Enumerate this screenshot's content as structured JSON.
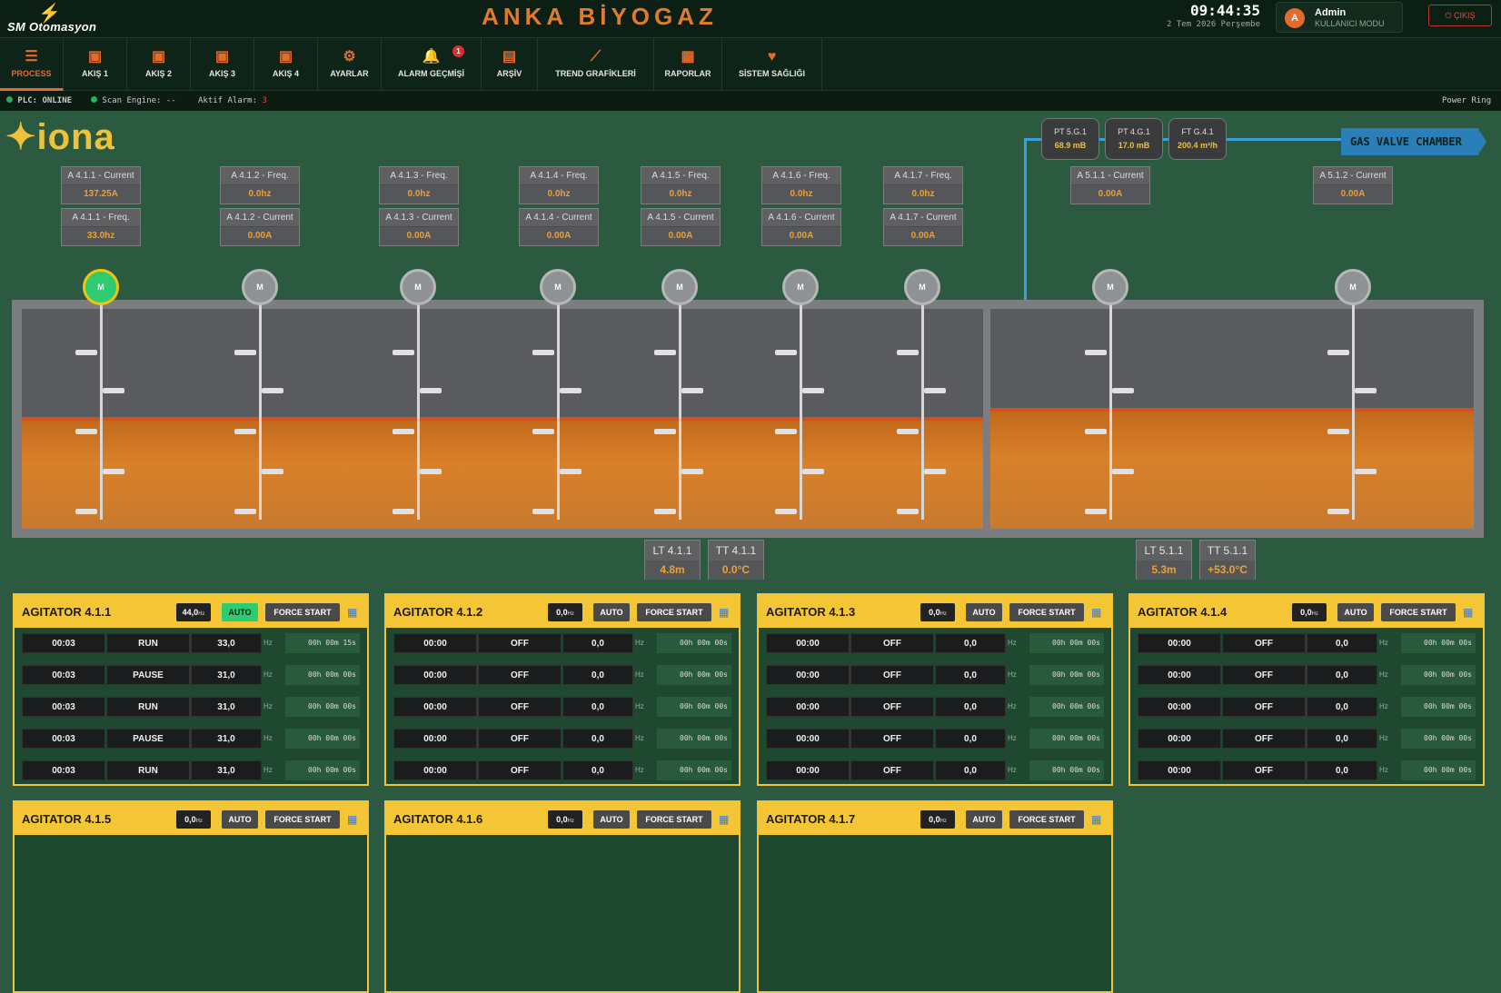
{
  "header": {
    "logo_text": "SM Otomasyon",
    "title": "ANKA BİYOGAZ",
    "time": "09:44:35",
    "date": "2 Tem 2026 Perşembe",
    "user_initial": "A",
    "user_name": "Admin",
    "user_role": "KULLANICI MODU",
    "logout_label": "ÇIKIŞ"
  },
  "nav": [
    {
      "label": "PROCESS",
      "icon": "list-icon",
      "glyph": "☰",
      "active": true
    },
    {
      "label": "AKIŞ 1",
      "icon": "calendar-icon",
      "glyph": "▣"
    },
    {
      "label": "AKIŞ 2",
      "icon": "calendar-icon",
      "glyph": "▣"
    },
    {
      "label": "AKIŞ 3",
      "icon": "calendar-icon",
      "glyph": "▣"
    },
    {
      "label": "AKIŞ 4",
      "icon": "calendar-icon",
      "glyph": "▣"
    },
    {
      "label": "AYARLAR",
      "icon": "gear-icon",
      "glyph": "⚙"
    },
    {
      "label": "ALARM GEÇMİŞİ",
      "icon": "bell-icon",
      "glyph": "🔔",
      "badge": "1"
    },
    {
      "label": "ARŞİV",
      "icon": "archive-icon",
      "glyph": "▤"
    },
    {
      "label": "TREND GRAFİKLERİ",
      "icon": "trend-icon",
      "glyph": "⟋"
    },
    {
      "label": "RAPORLAR",
      "icon": "report-icon",
      "glyph": "▦"
    },
    {
      "label": "SİSTEM SAĞLIĞI",
      "icon": "heart-icon",
      "glyph": "♥"
    }
  ],
  "status": {
    "plc": "PLC: ONLINE",
    "scan": "Scan Engine: --",
    "alarm_label": "Aktif Alarm:",
    "alarm_count": "3",
    "ring": "Power Ring"
  },
  "brand": "✦iona",
  "gas_sensors": [
    {
      "label": "PT 5.G.1",
      "value": "68.9 mB"
    },
    {
      "label": "PT 4.G.1",
      "value": "17.0 mB"
    },
    {
      "label": "FT G.4.1",
      "value": "200.4 m³/h"
    }
  ],
  "gas_valve_label": "GAS VALVE CHAMBER",
  "tags": [
    {
      "top_label": "A 4.1.1 - Current",
      "top_value": "137.25A",
      "bot_label": "A 4.1.1 - Freq.",
      "bot_value": "33.0hz"
    },
    {
      "top_label": "A 4.1.2 - Freq.",
      "top_value": "0.0hz",
      "bot_label": "A 4.1.2 - Current",
      "bot_value": "0.00A"
    },
    {
      "top_label": "A 4.1.3 - Freq.",
      "top_value": "0.0hz",
      "bot_label": "A 4.1.3 - Current",
      "bot_value": "0.00A"
    },
    {
      "top_label": "A 4.1.4 - Freq.",
      "top_value": "0.0hz",
      "bot_label": "A 4.1.4 - Current",
      "bot_value": "0.00A"
    },
    {
      "top_label": "A 4.1.5 - Freq.",
      "top_value": "0.0hz",
      "bot_label": "A 4.1.5 - Current",
      "bot_value": "0.00A"
    },
    {
      "top_label": "A 4.1.6 - Freq.",
      "top_value": "0.0hz",
      "bot_label": "A 4.1.6 - Current",
      "bot_value": "0.00A"
    },
    {
      "top_label": "A 4.1.7 - Freq.",
      "top_value": "0.0hz",
      "bot_label": "A 4.1.7 - Current",
      "bot_value": "0.00A"
    },
    {
      "top_label": "A 5.1.1 - Current",
      "top_value": "0.00A"
    },
    {
      "top_label": "A 5.1.2 - Current",
      "top_value": "0.00A"
    }
  ],
  "motor_label": "M",
  "motors_running": [
    true,
    false,
    false,
    false,
    false,
    false,
    false,
    false,
    false
  ],
  "tank_sensors": [
    {
      "label": "LT 4.1.1",
      "value": "4.8m"
    },
    {
      "label": "TT 4.1.1",
      "value": "0.0°C"
    },
    {
      "label": "LT 5.1.1",
      "value": "5.3m"
    },
    {
      "label": "TT 5.1.1",
      "value": "+53.0°C"
    }
  ],
  "agitators": [
    {
      "title": "AGITATOR 4.1.1",
      "hz": "44,0",
      "auto": "AUTO",
      "auto_on": true,
      "force": "FORCE START",
      "rows": [
        {
          "time": "00:03",
          "state": "RUN",
          "freq": "33,0",
          "dur": "00h 00m 15s"
        },
        {
          "time": "00:03",
          "state": "PAUSE",
          "freq": "31,0",
          "dur": "00h 00m 00s"
        },
        {
          "time": "00:03",
          "state": "RUN",
          "freq": "31,0",
          "dur": "00h 00m 00s"
        },
        {
          "time": "00:03",
          "state": "PAUSE",
          "freq": "31,0",
          "dur": "00h 00m 00s"
        },
        {
          "time": "00:03",
          "state": "RUN",
          "freq": "31,0",
          "dur": "00h 00m 00s"
        }
      ]
    },
    {
      "title": "AGITATOR 4.1.2",
      "hz": "0,0",
      "auto": "AUTO",
      "auto_on": false,
      "force": "FORCE START",
      "rows": [
        {
          "time": "00:00",
          "state": "OFF",
          "freq": "0,0",
          "dur": "00h 00m 00s"
        },
        {
          "time": "00:00",
          "state": "OFF",
          "freq": "0,0",
          "dur": "00h 00m 00s"
        },
        {
          "time": "00:00",
          "state": "OFF",
          "freq": "0,0",
          "dur": "00h 00m 00s"
        },
        {
          "time": "00:00",
          "state": "OFF",
          "freq": "0,0",
          "dur": "00h 00m 00s"
        },
        {
          "time": "00:00",
          "state": "OFF",
          "freq": "0,0",
          "dur": "00h 00m 00s"
        }
      ]
    },
    {
      "title": "AGITATOR 4.1.3",
      "hz": "0,0",
      "auto": "AUTO",
      "auto_on": false,
      "force": "FORCE START",
      "rows": [
        {
          "time": "00:00",
          "state": "OFF",
          "freq": "0,0",
          "dur": "00h 00m 00s"
        },
        {
          "time": "00:00",
          "state": "OFF",
          "freq": "0,0",
          "dur": "00h 00m 00s"
        },
        {
          "time": "00:00",
          "state": "OFF",
          "freq": "0,0",
          "dur": "00h 00m 00s"
        },
        {
          "time": "00:00",
          "state": "OFF",
          "freq": "0,0",
          "dur": "00h 00m 00s"
        },
        {
          "time": "00:00",
          "state": "OFF",
          "freq": "0,0",
          "dur": "00h 00m 00s"
        }
      ]
    },
    {
      "title": "AGITATOR 4.1.4",
      "hz": "0,0",
      "auto": "AUTO",
      "auto_on": false,
      "force": "FORCE START",
      "rows": [
        {
          "time": "00:00",
          "state": "OFF",
          "freq": "0,0",
          "dur": "00h 00m 00s"
        },
        {
          "time": "00:00",
          "state": "OFF",
          "freq": "0,0",
          "dur": "00h 00m 00s"
        },
        {
          "time": "00:00",
          "state": "OFF",
          "freq": "0,0",
          "dur": "00h 00m 00s"
        },
        {
          "time": "00:00",
          "state": "OFF",
          "freq": "0,0",
          "dur": "00h 00m 00s"
        },
        {
          "time": "00:00",
          "state": "OFF",
          "freq": "0,0",
          "dur": "00h 00m 00s"
        }
      ]
    },
    {
      "title": "AGITATOR 4.1.5",
      "hz": "0,0",
      "auto": "AUTO",
      "auto_on": false,
      "force": "FORCE START",
      "rows": []
    },
    {
      "title": "AGITATOR 4.1.6",
      "hz": "0,0",
      "auto": "AUTO",
      "auto_on": false,
      "force": "FORCE START",
      "rows": []
    },
    {
      "title": "AGITATOR 4.1.7",
      "hz": "0,0",
      "auto": "AUTO",
      "auto_on": false,
      "force": "FORCE START",
      "rows": []
    }
  ],
  "hz_unit": "Hz",
  "colors": {
    "accent": "#e36b2c",
    "panel": "#f4c636",
    "running": "#2ecc71",
    "liquid": "#d8802a"
  }
}
